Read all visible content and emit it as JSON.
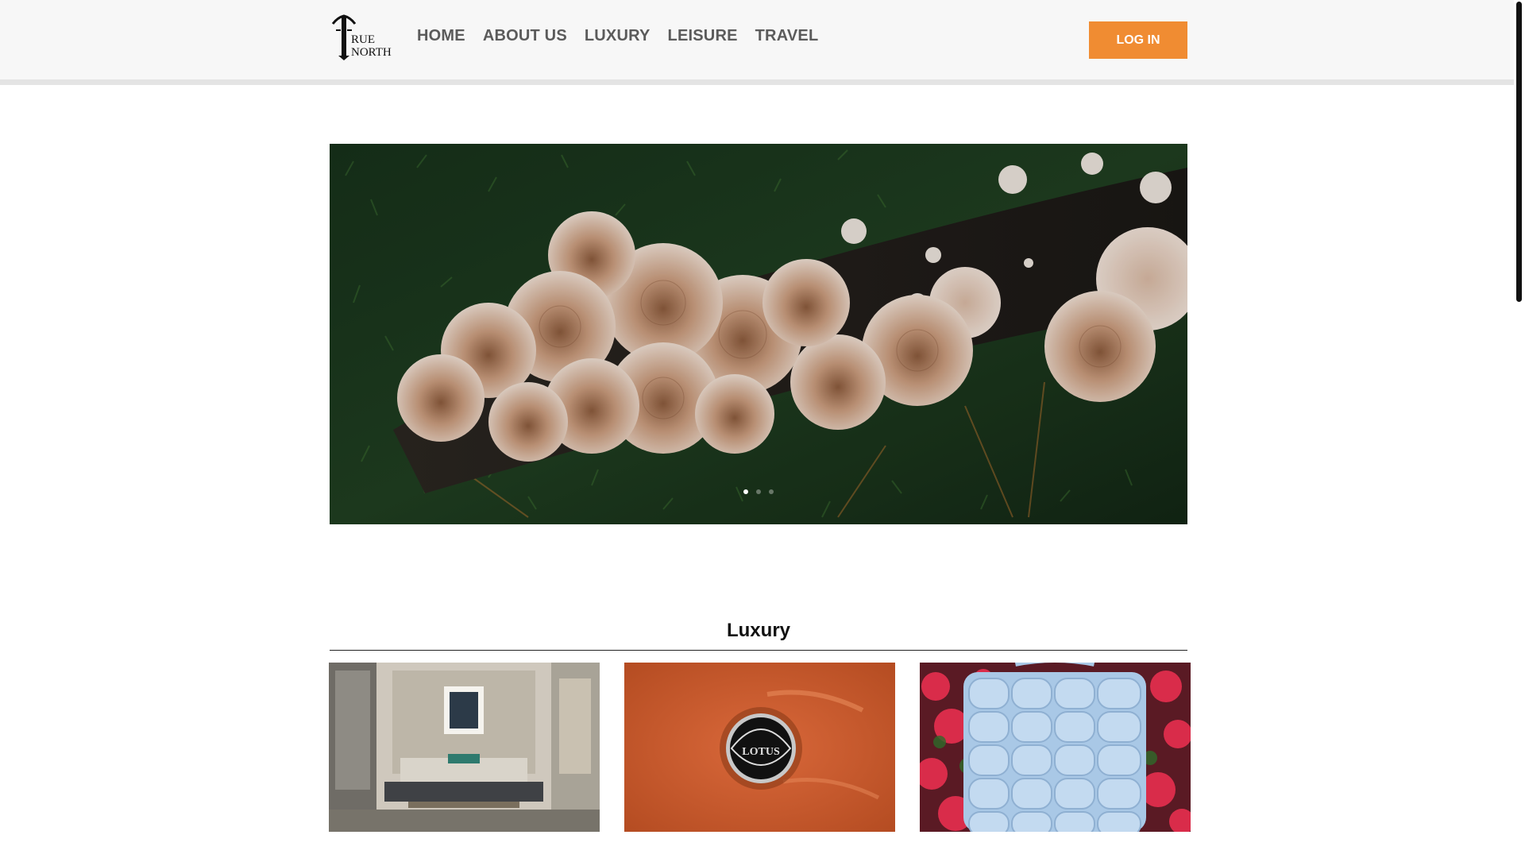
{
  "header": {
    "logo_text": "TRUE NORTH",
    "nav": [
      {
        "label": "HOME"
      },
      {
        "label": "ABOUT US"
      },
      {
        "label": "LUXURY"
      },
      {
        "label": "LEISURE"
      },
      {
        "label": "TRAVEL"
      }
    ],
    "login_label": "LOG IN"
  },
  "hero": {
    "subject": "mushrooms-on-mossy-log",
    "slide_count": 3,
    "active_slide": 1
  },
  "luxury": {
    "title": "Luxury",
    "cards": [
      {
        "subject": "bedroom-interior"
      },
      {
        "subject": "lotus-car-badge",
        "badge_text": "LOTUS"
      },
      {
        "subject": "quilted-blue-bag"
      }
    ]
  },
  "colors": {
    "accent": "#f08c32",
    "header_bg": "#f7f7f7",
    "nav_text": "#5b5b5b"
  }
}
